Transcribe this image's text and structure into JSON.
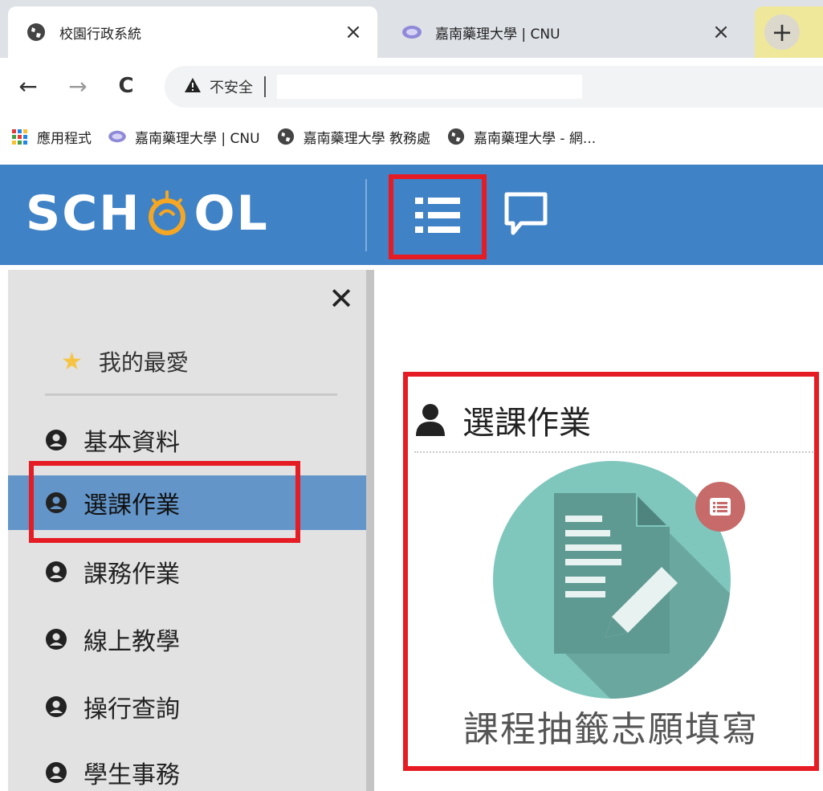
{
  "browser": {
    "tabs": [
      {
        "title": "校園行政系統",
        "favicon": "globe-icon",
        "close": "×",
        "active": true
      },
      {
        "title": "嘉南藥理大學 | CNU",
        "favicon": "cnu-logo-icon",
        "close": "×",
        "active": false
      }
    ],
    "new_tab": "+",
    "nav": {
      "back": "←",
      "forward": "→",
      "reload": "C"
    },
    "address": {
      "security_icon": "warning-icon",
      "security_label": "不安全",
      "separator": "|"
    },
    "bookmarks": [
      {
        "label": "應用程式",
        "icon": "apps-grid-icon"
      },
      {
        "label": "嘉南藥理大學 | CNU",
        "icon": "cnu-logo-icon"
      },
      {
        "label": "嘉南藥理大學 教務處",
        "icon": "globe-icon"
      },
      {
        "label": "嘉南藥理大學 - 網...",
        "icon": "globe-icon"
      }
    ]
  },
  "header": {
    "logo_left": "SCH",
    "logo_right": "OL",
    "menu_icon": "list-icon",
    "chat_icon": "chat-bubble-icon",
    "bg_color": "#3f82c6"
  },
  "sidebar": {
    "close": "✕",
    "favorites_label": "我的最愛",
    "items": [
      {
        "label": "基本資料",
        "active": false
      },
      {
        "label": "選課作業",
        "active": true
      },
      {
        "label": "課務作業",
        "active": false
      },
      {
        "label": "線上教學",
        "active": false
      },
      {
        "label": "操行查詢",
        "active": false
      },
      {
        "label": "學生事務",
        "active": false
      }
    ]
  },
  "main": {
    "section_title": "選課作業",
    "course_item_label": "課程抽籤志願填寫",
    "course_icon": "document-edit-icon",
    "badge_icon": "list-badge-icon"
  },
  "colors": {
    "highlight_red": "#e51c23",
    "active_item": "#6395c9",
    "icon_teal": "#7fc7bd",
    "badge": "#c66a6a"
  }
}
